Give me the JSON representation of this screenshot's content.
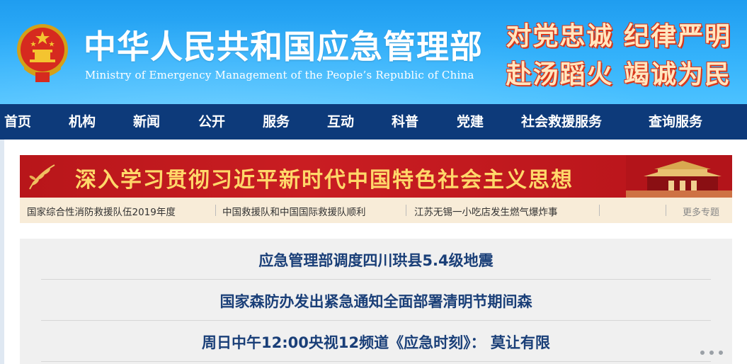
{
  "header": {
    "title_cn": "中华人民共和国应急管理部",
    "title_en": "Ministry of Emergency Management of the People’s Republic of China",
    "slogan_line1": "对党忠诚  纪律严明",
    "slogan_line2": "赴汤蹈火  竭诚为民",
    "emblem_icon": "national-emblem-icon"
  },
  "nav": {
    "items": [
      "首页",
      "机构",
      "新闻",
      "公开",
      "服务",
      "互动",
      "科普",
      "党建",
      "社会救援服务",
      "查询服务"
    ]
  },
  "banner": {
    "text": "深入学习贯彻习近平新时代中国特色社会主义思想"
  },
  "ticker": {
    "items": [
      "国家综合性消防救援队伍2019年度",
      "中国救援队和中国国际救援队顺利",
      "江苏无锡一小吃店发生燃气爆炸事"
    ],
    "more_label": "更多专题"
  },
  "headlines": [
    "应急管理部调度四川珙县5.4级地震",
    "国家森防办发出紧急通知全面部署清明节期间森",
    "周日中午12:00央视12频道《应急时刻》： 莫让有限"
  ],
  "colors": {
    "header_blue": "#2aa8f6",
    "nav_bg": "#0d3a7a",
    "banner_red": "#c21b20",
    "banner_text": "#ffd86a",
    "headline_text": "#1a3f78",
    "ticker_bg": "#f8ecd8"
  }
}
